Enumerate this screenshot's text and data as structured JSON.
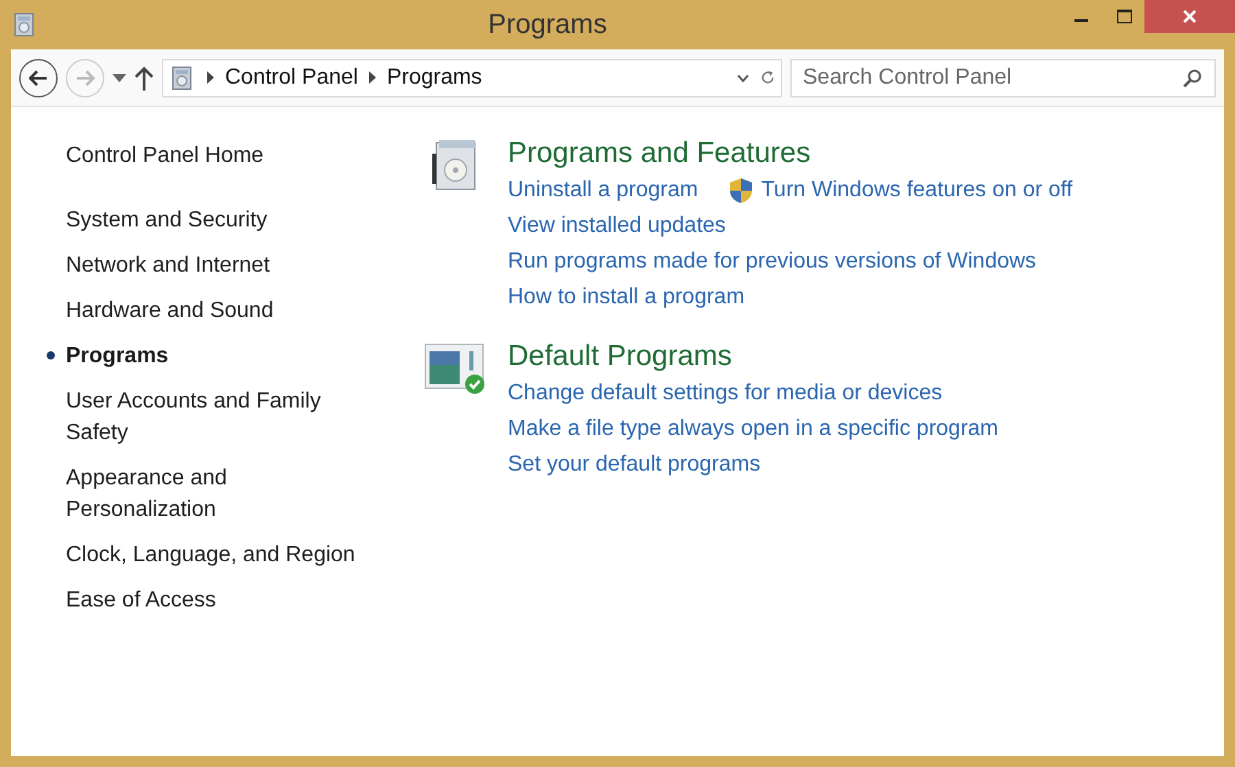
{
  "window": {
    "title": "Programs"
  },
  "nav": {
    "back_disabled": false,
    "forward_disabled": true,
    "breadcrumbs": [
      "Control Panel",
      "Programs"
    ],
    "search": {
      "placeholder": "Search Control Panel"
    }
  },
  "sidebar": {
    "items": [
      {
        "label": "Control Panel Home",
        "selected": false,
        "kind": "home"
      },
      {
        "label": "System and Security",
        "selected": false,
        "kind": "category"
      },
      {
        "label": "Network and Internet",
        "selected": false,
        "kind": "category"
      },
      {
        "label": "Hardware and Sound",
        "selected": false,
        "kind": "category"
      },
      {
        "label": "Programs",
        "selected": true,
        "kind": "category"
      },
      {
        "label": "User Accounts and Family Safety",
        "selected": false,
        "kind": "category"
      },
      {
        "label": "Appearance and Personalization",
        "selected": false,
        "kind": "category"
      },
      {
        "label": "Clock, Language, and Region",
        "selected": false,
        "kind": "category"
      },
      {
        "label": "Ease of Access",
        "selected": false,
        "kind": "category"
      }
    ]
  },
  "sections": [
    {
      "title": "Programs and Features",
      "kind": "features",
      "rows": [
        [
          {
            "text": "Uninstall a program",
            "shield": false
          },
          {
            "text": "Turn Windows features on or off",
            "shield": true
          }
        ],
        [
          {
            "text": "View installed updates",
            "shield": false
          }
        ],
        [
          {
            "text": "Run programs made for previous versions of Windows",
            "shield": false
          }
        ],
        [
          {
            "text": "How to install a program",
            "shield": false
          }
        ]
      ]
    },
    {
      "title": "Default Programs",
      "kind": "defaults",
      "rows": [
        [
          {
            "text": "Change default settings for media or devices",
            "shield": false
          }
        ],
        [
          {
            "text": "Make a file type always open in a specific program",
            "shield": false
          }
        ],
        [
          {
            "text": "Set your default programs",
            "shield": false
          }
        ]
      ]
    }
  ]
}
